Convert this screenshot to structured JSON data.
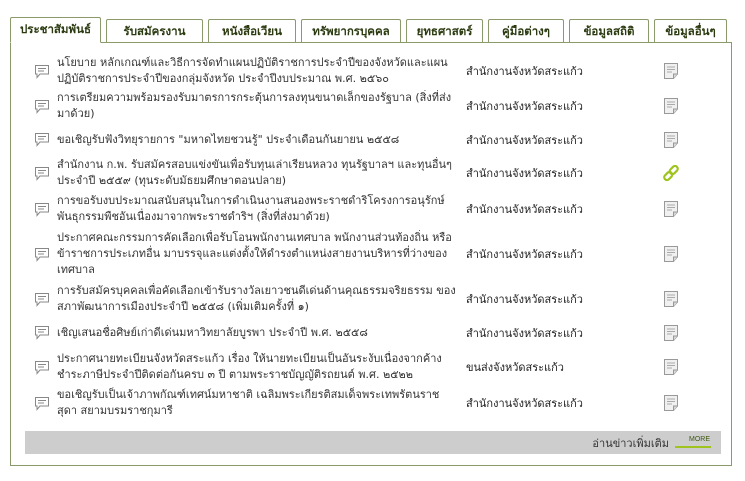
{
  "tabs": [
    {
      "label": "ประชาสัมพันธ์",
      "active": true
    },
    {
      "label": "รับสมัครงาน",
      "active": false
    },
    {
      "label": "หนังสือเวียน",
      "active": false
    },
    {
      "label": "ทรัพยากรบุคคล",
      "active": false
    },
    {
      "label": "ยุทธศาสตร์",
      "active": false
    },
    {
      "label": "คู่มือต่างๆ",
      "active": false
    },
    {
      "label": "ข้อมูลสถิติ",
      "active": false
    },
    {
      "label": "ข้อมูลอื่นๆ",
      "active": false
    }
  ],
  "news": [
    {
      "title": "นโยบาย หลักเกณฑ์และวิธีการจัดทำแผนปฏิบัติราชการประจำปีของจังหวัดและแผนปฏิบัติราชการประจำปีของกลุ่มจังหวัด ประจำปีงบประมาณ พ.ศ. ๒๕๖๐",
      "agency": "สำนักงานจังหวัดสระแก้ว",
      "attachment": "document-icon"
    },
    {
      "title": "การเตรียมความพร้อมรองรับมาตรการกระตุ้นการลงทุนขนาดเล็กของรัฐบาล (สิ่งที่ส่งมาด้วย)",
      "agency": "สำนักงานจังหวัดสระแก้ว",
      "attachment": "document-icon"
    },
    {
      "title": "ขอเชิญรับฟังวิทยุรายการ \"มหาดไทยชวนรู้\" ประจำเดือนกันยายน ๒๕๕๘",
      "agency": "สำนักงานจังหวัดสระแก้ว",
      "attachment": "document-icon"
    },
    {
      "title": "สำนักงาน ก.พ. รับสมัครสอบแข่งขันเพื่อรับทุนเล่าเรียนหลวง ทุนรัฐบาลฯ และทุนอื่นๆ ประจำปี ๒๕๕๙ (ทุนระดับมัธยมศึกษาตอนปลาย)",
      "agency": "สำนักงานจังหวัดสระแก้ว",
      "attachment": "link-icon"
    },
    {
      "title": "การขอรับงบประมาณสนับสนุนในการดำเนินงานสนองพระราชดำริโครงการอนุรักษ์พันธุกรรมพืชอันเนื่องมาจากพระราชดำริฯ (สิ่งที่ส่งมาด้วย)",
      "agency": "สำนักงานจังหวัดสระแก้ว",
      "attachment": "document-icon"
    },
    {
      "title": "ประกาศคณะกรรมการคัดเลือกเพื่อรับโอนพนักงานเทศบาล พนักงานส่วนท้องถิ่น หรือข้าราชการประเภทอื่น มาบรรจุและแต่งตั้งให้ดำรงตำแหน่งสายงานบริหารที่ว่างของเทศบาล",
      "agency": "สำนักงานจังหวัดสระแก้ว",
      "attachment": "document-icon"
    },
    {
      "title": "การรับสมัครบุคคลเพื่อคัดเลือกเข้ารับรางวัลเยาวชนดีเด่นด้านคุณธรรมจริยธรรม ของสภาพัฒนาการเมืองประจำปี ๒๕๕๘ (เพิ่มเติมครั้งที่ ๑)",
      "agency": "สำนักงานจังหวัดสระแก้ว",
      "attachment": "document-icon"
    },
    {
      "title": "เชิญเสนอชื่อศิษย์เก่าดีเด่นมหาวิทยาลัยบูรพา ประจำปี พ.ศ. ๒๕๕๘",
      "agency": "สำนักงานจังหวัดสระแก้ว",
      "attachment": "document-icon"
    },
    {
      "title": "ประกาศนายทะเบียนจังหวัดสระแก้ว เรื่อง ให้นายทะเบียนเป็นอันระงับเนื่องจากค้างชำระภาษีประจำปีติดต่อกันครบ ๓ ปี ตามพระราชบัญญัติรถยนต์ พ.ศ. ๒๕๒๒",
      "agency": "ขนส่งจังหวัดสระแก้ว",
      "attachment": "document-icon"
    },
    {
      "title": "ขอเชิญรับเป็นเจ้าภาพกัณฑ์เทศน์มหาชาติ เฉลิมพระเกียรติสมเด็จพระเทพรัตนราชสุดา สยามบรมราชกุมารี",
      "agency": "สำนักงานจังหวัดสระแก้ว",
      "attachment": "document-icon"
    }
  ],
  "footer": {
    "more_label": "อ่านข่าวเพิ่มเติม",
    "badge_text": "MORE"
  },
  "colors": {
    "tab_border": "#8a9a6a",
    "footer_bg": "#cdcdcd",
    "link_icon": "#9fc41e",
    "doc_icon": "#f0f0f0"
  }
}
